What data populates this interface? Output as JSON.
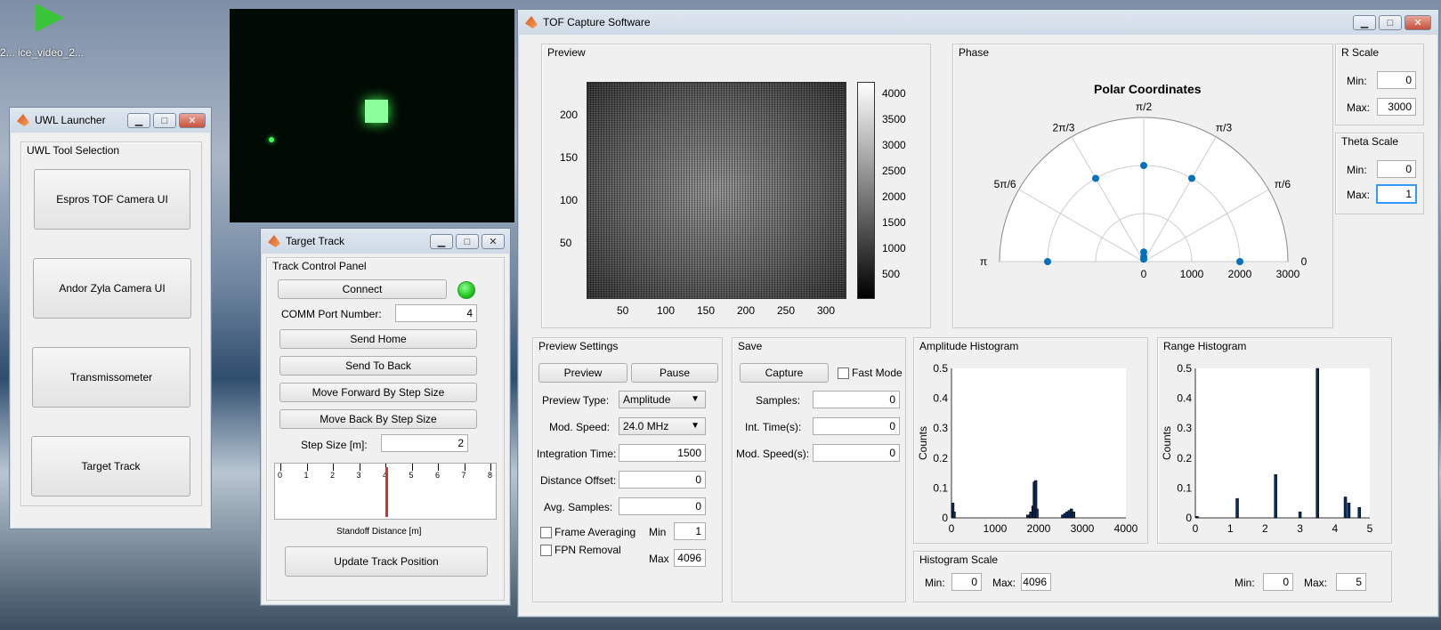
{
  "desktop": {
    "icon_label": "ice_video_2...",
    "icon_label_left": "2..."
  },
  "uwl": {
    "title": "UWL Launcher",
    "group": "UWL Tool Selection",
    "buttons": [
      "Espros TOF Camera UI",
      "Andor Zyla Camera UI",
      "Transmissometer",
      "Target Track"
    ]
  },
  "track": {
    "title": "Target Track",
    "panel": "Track Control Panel",
    "connect": "Connect",
    "comm_label": "COMM Port Number:",
    "comm_value": "4",
    "send_home": "Send Home",
    "send_back": "Send To Back",
    "move_fwd": "Move Forward By Step Size",
    "move_back": "Move Back By Step Size",
    "step_label": "Step Size [m]:",
    "step_value": "2",
    "ruler_ticks": [
      "0",
      "1",
      "2",
      "3",
      "4",
      "5",
      "6",
      "7",
      "8"
    ],
    "ruler_label": "Standoff Distance [m]",
    "ruler_marker": 4,
    "update": "Update Track Position",
    "status_color": "#22cc22"
  },
  "tof": {
    "title": "TOF Capture Software",
    "preview": {
      "label": "Preview",
      "y_ticks": [
        "200",
        "150",
        "100",
        "50"
      ],
      "x_ticks": [
        "50",
        "100",
        "150",
        "200",
        "250",
        "300"
      ],
      "cbar_ticks": [
        "4000",
        "3500",
        "3000",
        "2500",
        "2000",
        "1500",
        "1000",
        "500"
      ]
    },
    "phase": {
      "label": "Phase",
      "title": "Polar Coordinates",
      "angles": [
        "π/2",
        "2π/3",
        "π/3",
        "5π/6",
        "π/6",
        "π",
        "0"
      ],
      "r_ticks": [
        "0",
        "1000",
        "2000",
        "3000"
      ]
    },
    "rscale": {
      "label": "R Scale",
      "min_label": "Min:",
      "min": "0",
      "max_label": "Max:",
      "max": "3000"
    },
    "theta": {
      "label": "Theta Scale",
      "min_label": "Min:",
      "min": "0",
      "max_label": "Max:",
      "max": "1"
    },
    "settings": {
      "label": "Preview Settings",
      "preview_btn": "Preview",
      "pause_btn": "Pause",
      "type_label": "Preview Type:",
      "type_value": "Amplitude",
      "speed_label": "Mod. Speed:",
      "speed_value": "24.0 MHz",
      "int_label": "Integration Time:",
      "int_value": "1500",
      "dist_label": "Distance Offset:",
      "dist_value": "0",
      "avg_label": "Avg. Samples:",
      "avg_value": "0",
      "frame_avg": "Frame Averaging",
      "fpn": "FPN Removal",
      "min_label": "Min",
      "min_value": "1",
      "max_label": "Max",
      "max_value": "4096"
    },
    "save": {
      "label": "Save",
      "capture": "Capture",
      "fast": "Fast Mode",
      "samples_label": "Samples:",
      "samples": "0",
      "int_label": "Int. Time(s):",
      "int": "0",
      "mod_label": "Mod. Speed(s):",
      "mod": "0"
    },
    "amp_hist": {
      "label": "Amplitude Histogram",
      "ylabel": "Counts",
      "y_ticks": [
        "0.5",
        "0.4",
        "0.3",
        "0.2",
        "0.1",
        "0"
      ],
      "x_ticks": [
        "0",
        "1000",
        "2000",
        "3000",
        "4000"
      ]
    },
    "range_hist": {
      "label": "Range Histogram",
      "ylabel": "Counts",
      "y_ticks": [
        "0.5",
        "0.4",
        "0.3",
        "0.2",
        "0.1",
        "0"
      ],
      "x_ticks": [
        "0",
        "1",
        "2",
        "3",
        "4",
        "5"
      ]
    },
    "hist_scale": {
      "label": "Histogram Scale",
      "min_label": "Min:",
      "amp_min": "0",
      "max_label": "Max:",
      "amp_max": "4096",
      "range_min": "0",
      "range_max": "5"
    }
  },
  "chart_data": [
    {
      "type": "bar",
      "title": "",
      "xlabel": "",
      "ylabel": "Counts",
      "xlim": [
        0,
        4000
      ],
      "ylim": [
        0,
        0.5
      ],
      "x": [
        30,
        60,
        1750,
        1820,
        1870,
        1900,
        1930,
        1960,
        2550,
        2600,
        2650,
        2700,
        2750,
        2800
      ],
      "values": [
        0.05,
        0.02,
        0.01,
        0.02,
        0.04,
        0.12,
        0.125,
        0.03,
        0.01,
        0.015,
        0.02,
        0.025,
        0.03,
        0.02
      ]
    },
    {
      "type": "bar",
      "title": "",
      "xlabel": "",
      "ylabel": "Counts",
      "xlim": [
        0,
        5
      ],
      "ylim": [
        0,
        0.5
      ],
      "x": [
        0.05,
        1.2,
        2.3,
        3.5,
        3.0,
        4.3,
        4.4,
        4.7
      ],
      "values": [
        0.005,
        0.065,
        0.145,
        0.5,
        0.02,
        0.07,
        0.05,
        0.035
      ]
    },
    {
      "type": "scatter",
      "title": "Polar Coordinates",
      "xlabel": "",
      "ylabel": "",
      "r_lim": [
        0,
        3000
      ],
      "theta_lim": [
        0,
        3.1416
      ],
      "points": [
        {
          "r": 2000,
          "theta": 0
        },
        {
          "r": 2000,
          "theta": 3.1416
        },
        {
          "r": 2000,
          "theta": 1.5708
        },
        {
          "r": 2000,
          "theta": 1.0472
        },
        {
          "r": 2000,
          "theta": 2.0944
        },
        {
          "r": 200,
          "theta": 1.5708
        },
        {
          "r": 100,
          "theta": 1.5708
        },
        {
          "r": 50,
          "theta": 1.5708
        }
      ]
    }
  ]
}
